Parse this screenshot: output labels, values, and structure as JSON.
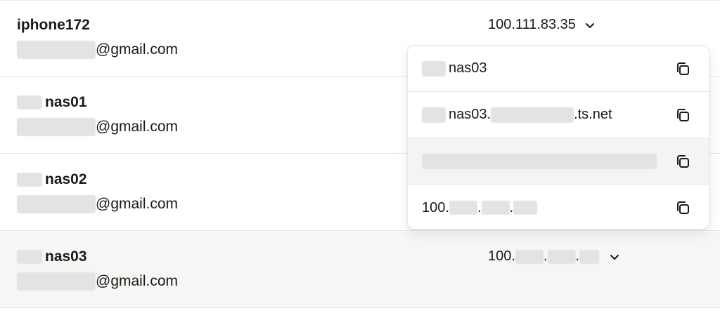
{
  "rows": [
    {
      "name": "iphone172",
      "email_suffix": "@gmail.com",
      "address": "100.111.83.35"
    },
    {
      "name": "nas01",
      "email_suffix": "@gmail.com"
    },
    {
      "name": "nas02",
      "email_suffix": "@gmail.com"
    },
    {
      "name": "nas03",
      "email_suffix": "@gmail.com",
      "address_prefix": "100.",
      "address_sep1": ".",
      "address_sep2": "."
    }
  ],
  "menu": {
    "items": [
      {
        "text": "nas03"
      },
      {
        "text_prefix": "nas03.",
        "text_suffix": ".ts.net"
      },
      {
        "text": ""
      },
      {
        "text_prefix": "100.",
        "sep1": ".",
        "sep2": "."
      }
    ]
  },
  "icons": {
    "chevron": "chevron-down-icon",
    "copy": "copy-icon"
  },
  "colors": {
    "text": "#1c1917",
    "divider": "#e7e5e4",
    "highlight": "#f7f6f4"
  }
}
